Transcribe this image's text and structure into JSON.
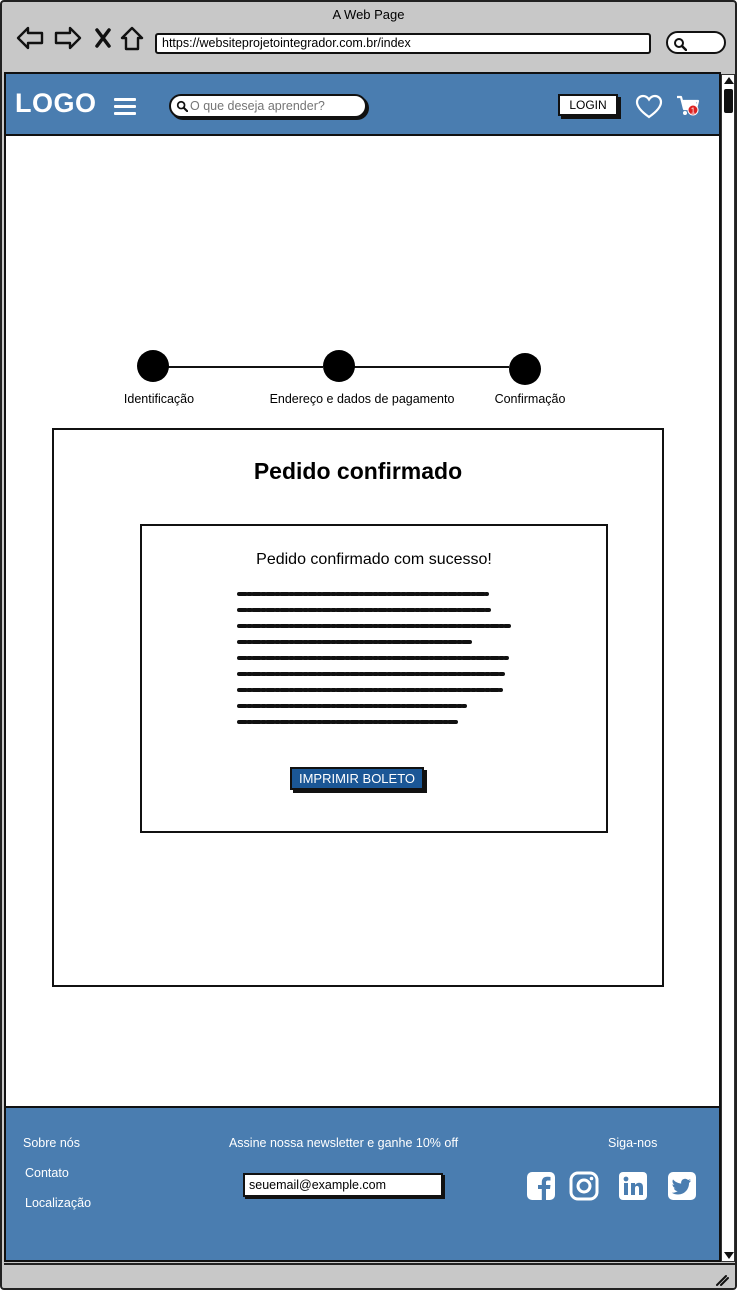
{
  "browser": {
    "title": "A Web Page",
    "url": "https://websiteprojetointegrador.com.br/index"
  },
  "header": {
    "logo": "LOGO",
    "search_placeholder": "O que deseja aprender?",
    "login_label": "LOGIN",
    "cart_count": "1"
  },
  "stepper": {
    "steps": [
      {
        "label": "Identificação"
      },
      {
        "label": "Endereço e dados de pagamento"
      },
      {
        "label": "Confirmação"
      }
    ]
  },
  "confirmation": {
    "title": "Pedido confirmado",
    "message": "Pedido confirmado com sucesso!",
    "print_button": "IMPRIMIR BOLETO"
  },
  "footer": {
    "links": [
      "Sobre nós",
      "Contato",
      "Localização"
    ],
    "newsletter_label": "Assine nossa newsletter e ganhe 10% off",
    "newsletter_value": "seuemail@example.com",
    "follow_label": "Siga-nos",
    "social_icons": [
      "facebook-icon",
      "instagram-icon",
      "linkedin-icon",
      "twitter-icon"
    ]
  },
  "colors": {
    "brand_blue": "#4a7db0",
    "button_blue": "#1b5796"
  }
}
